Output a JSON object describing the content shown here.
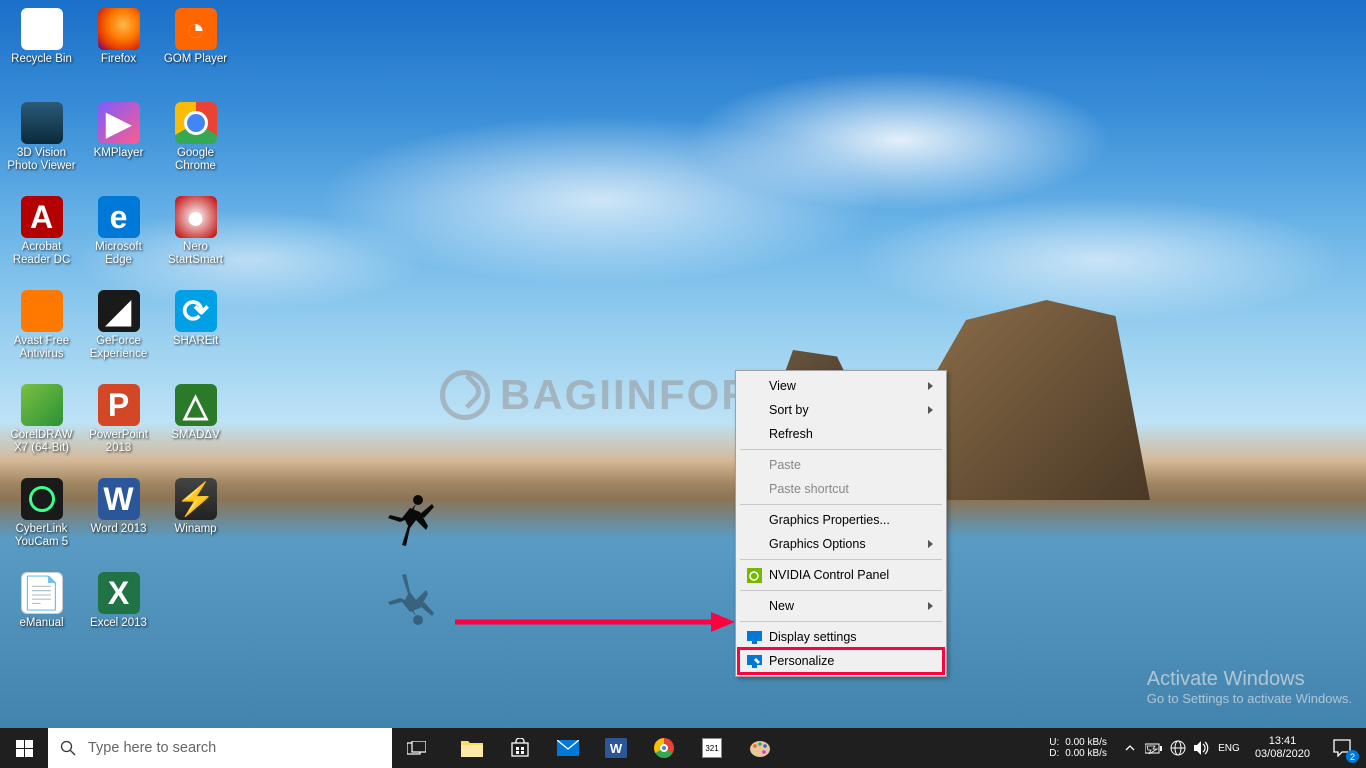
{
  "desktop_icons": [
    {
      "label": "Recycle Bin",
      "cls": "ic-recycle",
      "glyph": "🗑"
    },
    {
      "label": "Firefox",
      "cls": "ic-firefox",
      "glyph": ""
    },
    {
      "label": "GOM Player",
      "cls": "ic-gom",
      "glyph": "◔"
    },
    {
      "label": "3D Vision Photo Viewer",
      "cls": "ic-3d",
      "glyph": ""
    },
    {
      "label": "KMPlayer",
      "cls": "ic-km",
      "glyph": "▶"
    },
    {
      "label": "Google Chrome",
      "cls": "ic-chrome",
      "glyph": ""
    },
    {
      "label": "Acrobat Reader DC",
      "cls": "ic-acrobat",
      "glyph": "A"
    },
    {
      "label": "Microsoft Edge",
      "cls": "ic-edge",
      "glyph": "e"
    },
    {
      "label": "Nero StartSmart",
      "cls": "ic-nero",
      "glyph": "●"
    },
    {
      "label": "Avast Free Antivirus",
      "cls": "ic-avast",
      "glyph": ""
    },
    {
      "label": "GeForce Experience",
      "cls": "ic-geforce",
      "glyph": "◢"
    },
    {
      "label": "SHAREit",
      "cls": "ic-shareit",
      "glyph": "⟳"
    },
    {
      "label": "CorelDRAW X7 (64-Bit)",
      "cls": "ic-corel",
      "glyph": ""
    },
    {
      "label": "PowerPoint 2013",
      "cls": "ic-ppt",
      "glyph": "P"
    },
    {
      "label": "SMADΔV",
      "cls": "ic-smadav",
      "glyph": "△"
    },
    {
      "label": "CyberLink YouCam 5",
      "cls": "ic-youcam",
      "glyph": ""
    },
    {
      "label": "Word 2013",
      "cls": "ic-word",
      "glyph": "W"
    },
    {
      "label": "Winamp",
      "cls": "ic-winamp",
      "glyph": "⚡"
    },
    {
      "label": "eManual",
      "cls": "ic-emanual",
      "glyph": "📄"
    },
    {
      "label": "Excel 2013",
      "cls": "ic-excel",
      "glyph": "X"
    }
  ],
  "watermark_text": "BAGIINFORMASI",
  "context_menu": {
    "items": [
      {
        "label": "View",
        "type": "item",
        "arrow": true
      },
      {
        "label": "Sort by",
        "type": "item",
        "arrow": true
      },
      {
        "label": "Refresh",
        "type": "item"
      },
      {
        "type": "sep"
      },
      {
        "label": "Paste",
        "type": "item",
        "disabled": true
      },
      {
        "label": "Paste shortcut",
        "type": "item",
        "disabled": true
      },
      {
        "type": "sep"
      },
      {
        "label": "Graphics Properties...",
        "type": "item"
      },
      {
        "label": "Graphics Options",
        "type": "item",
        "arrow": true
      },
      {
        "type": "sep"
      },
      {
        "label": "NVIDIA Control Panel",
        "type": "item",
        "icon": "nvidia"
      },
      {
        "type": "sep"
      },
      {
        "label": "New",
        "type": "item",
        "arrow": true
      },
      {
        "type": "sep"
      },
      {
        "label": "Display settings",
        "type": "item",
        "icon": "display"
      },
      {
        "label": "Personalize",
        "type": "item",
        "icon": "personalize",
        "highlight": true
      }
    ]
  },
  "activate": {
    "heading": "Activate Windows",
    "sub": "Go to Settings to activate Windows."
  },
  "taskbar": {
    "search_placeholder": "Type here to search",
    "netspeed": {
      "up_label": "U:",
      "up_value": "0.00 kB/s",
      "down_label": "D:",
      "down_value": "0.00 kB/s"
    },
    "clock": {
      "time": "13:41",
      "date": "03/08/2020"
    },
    "action_center_badge": "2"
  }
}
